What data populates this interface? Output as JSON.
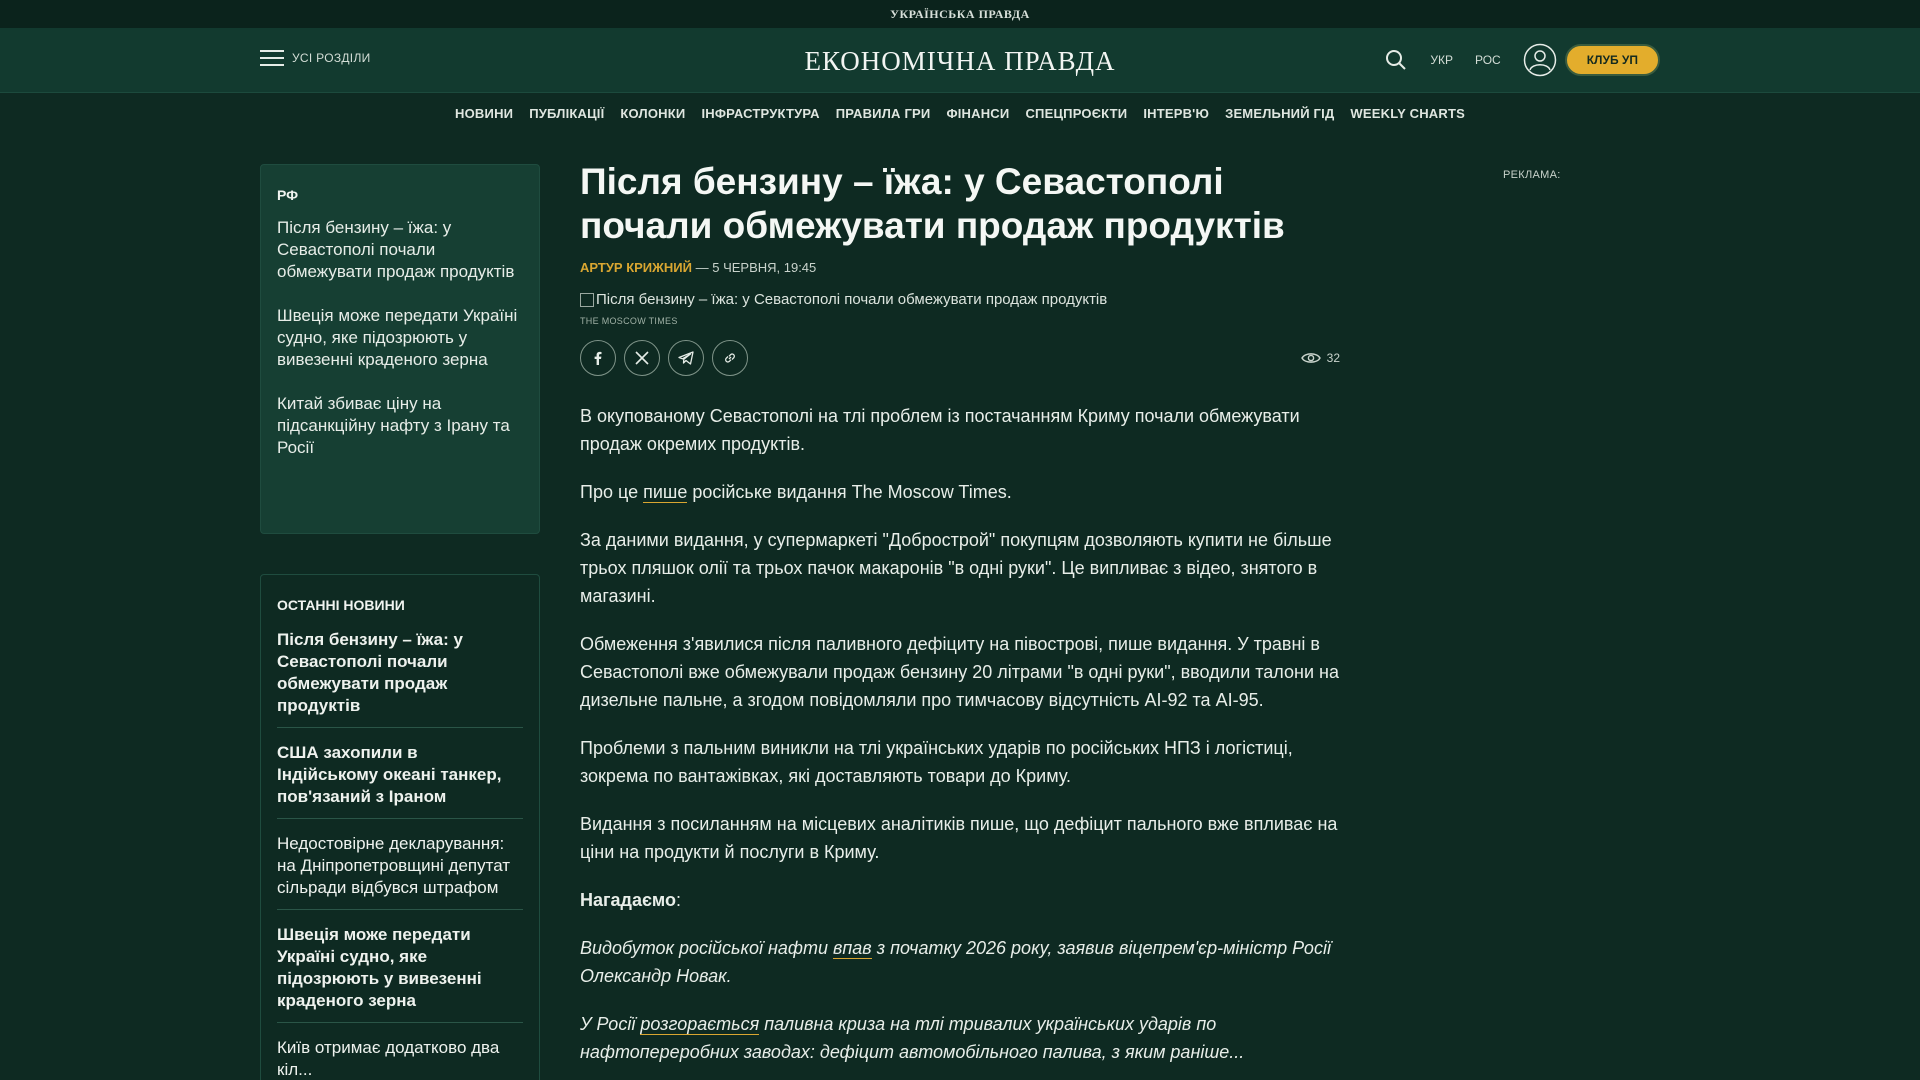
{
  "top_strip": {
    "label": "УКРАЇНСЬКА ПРАВДА"
  },
  "header": {
    "menu_label": "УСІ РОЗДІЛИ",
    "logo": "ЕКОНОМІЧНА ПРАВДА",
    "lang_ukr": "УКР",
    "lang_ros": "РОС",
    "club_label": "КЛУБ УП",
    "accent_color": "#e3ad2c"
  },
  "nav": {
    "items": [
      "НОВИНИ",
      "ПУБЛІКАЦІЇ",
      "КОЛОНКИ",
      "ІНФРАСТРУКТУРА",
      "ПРАВИЛА ГРИ",
      "ФІНАНСИ",
      "СПЕЦПРОЄКТИ",
      "ІНТЕРВ'Ю",
      "ЗЕМЕЛЬНИЙ ГІД",
      "WEEKLY CHARTS"
    ]
  },
  "sidebar": {
    "rf_title": "РФ",
    "rf_items": [
      "Після бензину – їжа: у Севастополі почали обмежувати продаж продуктів",
      "Швеція може передати Україні судно, яке підозрюють у вивезенні краденого зерна",
      "Китай збиває ціну на підсанкційну нафту з Ірану та Росії"
    ],
    "latest_title": "ОСТАННІ НОВИНИ",
    "latest_items": [
      "Після бензину – їжа: у Севастополі почали обмежувати продаж продуктів",
      "США захопили в Індійському океані танкер, пов'язаний з Іраном",
      "Недостовірне декларування: на Дніпропетровщині депутат сільради відбувся штрафом",
      "Швеція може передати Україні судно, яке підозрюють у вивезенні краденого зерна",
      "Київ отримає додатково два кіл..."
    ]
  },
  "article": {
    "title": "Після бензину – їжа: у Севастополі почали обмежувати продаж продуктів",
    "author": "АРТУР КРИЖНИЙ",
    "date": "— 5 ЧЕРВНЯ, 19:45",
    "image_alt": "Після бензину – їжа: у Севастополі почали обмежувати продаж продуктів",
    "image_credit": "THE MOSCOW TIMES",
    "views": "32",
    "p1": "В окупованому Севастополі на тлі проблем із постачанням Криму почали обмежувати продаж окремих продуктів.",
    "p2_pre": "Про це ",
    "p2_link": "пише",
    "p2_post": " російське видання The Moscow Times.",
    "p3": "За даними видання, у супермаркеті \"Добрострой\" покупцям дозволяють купити не більше трьох пляшок олії та трьох пачок макаронів \"в одні руки\". Це випливає з відео, знятого в магазині.",
    "p4": "Обмеження з'явилися після паливного дефіциту на півострові, пише видання. У травні в Севастополі вже обмежували продаж бензину 20 літрами \"в одні руки\", вводили талони на дизельне пальне, а згодом повідомляли про тимчасову відсутність АІ-92 та АІ-95.",
    "p5": "Проблеми з пальним виникли на тлі українських ударів по російських НПЗ і логістиці, зокрема по вантажівках, які доставляють товари до Криму.",
    "p6": "Видання з посиланням на місцевих аналітиків пише, що дефіцит пального вже впливає на ціни на продукти й послуги в Криму.",
    "reminder": "Нагадаємо",
    "reminder_colon": ":",
    "p7_pre": "Видобуток російської нафти ",
    "p7_link": "впав",
    "p7_post": " з початку 2026 року, заявив віцепрем'єр-міністр Росії Олександр Новак.",
    "p8_pre": "У Росії ",
    "p8_link": "розгорається",
    "p8_post": " паливна криза на тлі тривалих українських ударів по нафтопереробних заводах: дефіцит автомобільного палива, з яким раніше..."
  },
  "ad": {
    "label": "РЕКЛАМА:"
  }
}
